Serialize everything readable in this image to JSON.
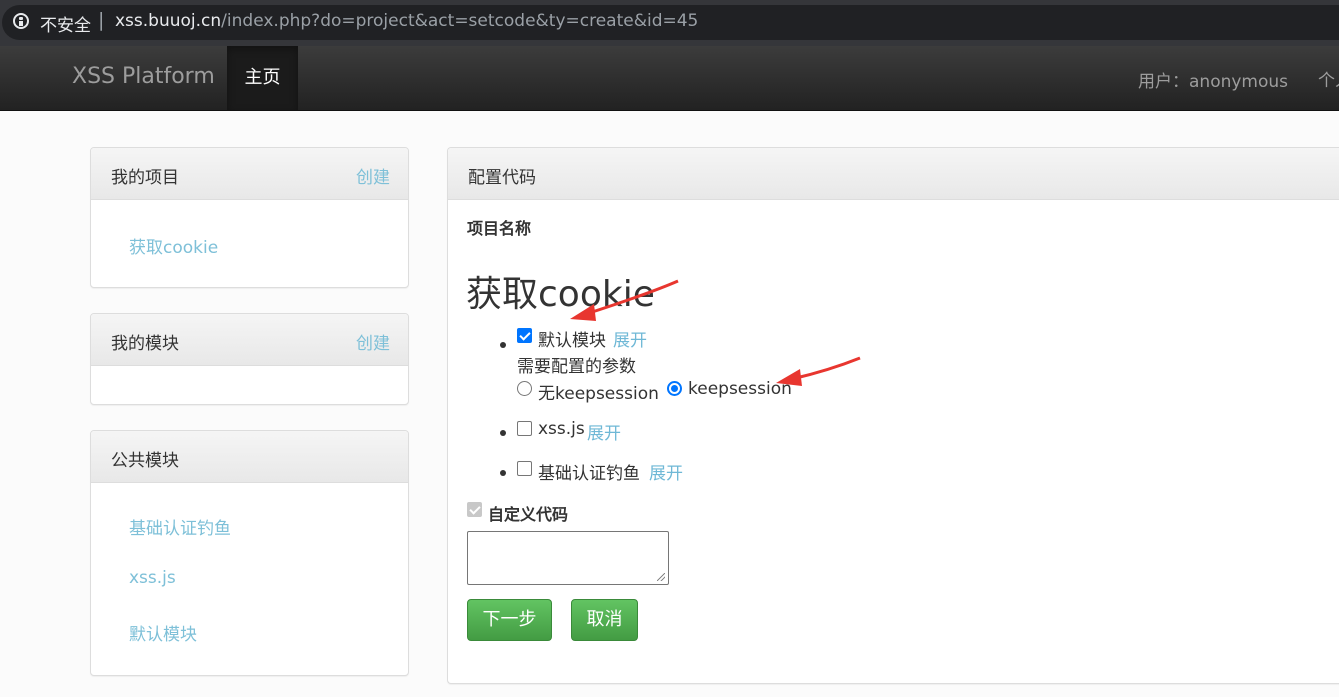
{
  "browser": {
    "security_label": "不安全",
    "separator": "|",
    "url_host": "xss.buuoj.cn",
    "url_path": "/index.php?do=project&act=setcode&ty=create&id=45"
  },
  "navbar": {
    "brand": "XSS Platform",
    "home": "主页",
    "user": "用户：anonymous",
    "cut_item": "个人"
  },
  "sidebar": {
    "my_projects": {
      "title": "我的项目",
      "create": "创建",
      "items": [
        "获取cookie"
      ]
    },
    "my_modules": {
      "title": "我的模块",
      "create": "创建",
      "items": []
    },
    "public_modules": {
      "title": "公共模块",
      "items": [
        "基础认证钓鱼",
        "xss.js",
        "默认模块"
      ]
    }
  },
  "main": {
    "panel_title": "配置代码",
    "project_name_label": "项目名称",
    "project_name": "获取cookie",
    "modules": [
      {
        "label": "默认模块",
        "expand": "展开",
        "checked": true,
        "params_label": "需要配置的参数",
        "options": [
          {
            "label": "无keepsession",
            "selected": false
          },
          {
            "label": "keepsession",
            "selected": true
          }
        ]
      },
      {
        "label": "xss.js",
        "expand": "展开",
        "checked": false
      },
      {
        "label": "基础认证钓鱼",
        "expand": "展开",
        "checked": false
      }
    ],
    "custom_code_label": "自定义代码",
    "custom_code_checked": true,
    "custom_code_value": "",
    "next_button": "下一步",
    "cancel_button": "取消"
  },
  "colors": {
    "link": "#7ec0d8",
    "button_green": "#4cae4c",
    "annotation_arrow": "#e8362f",
    "navbar": "#2b2b2b"
  }
}
